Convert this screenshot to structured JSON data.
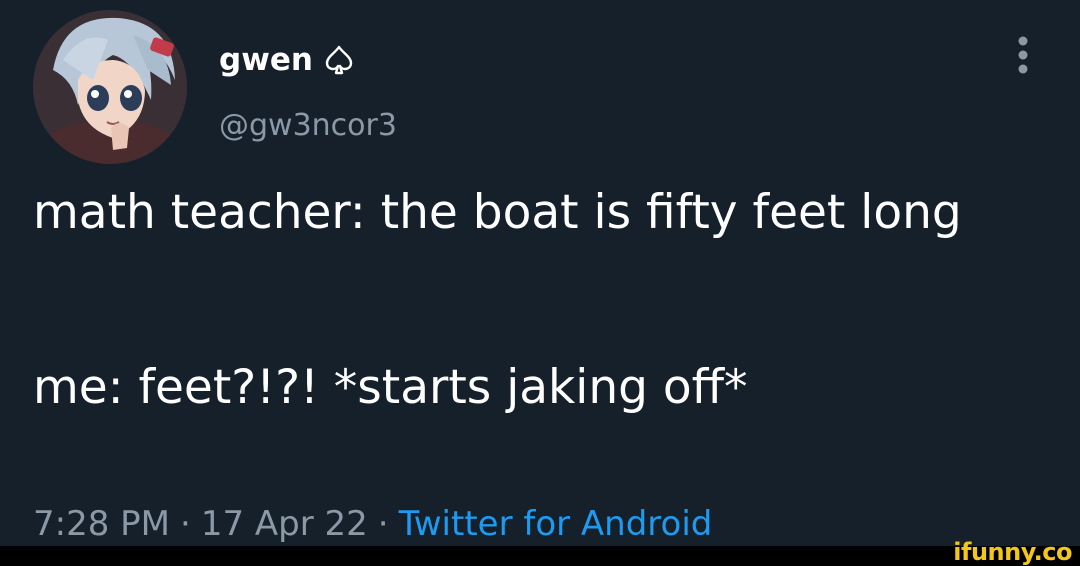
{
  "user": {
    "display_name": "gwen",
    "name_badge_icon": "spade-outline-icon",
    "handle": "@gw3ncor3",
    "avatar": "anime-character-avatar"
  },
  "menu": {
    "icon": "more-vertical-icon"
  },
  "tweet": {
    "line1": "math teacher: the boat is fifty feet long",
    "line2": "me: feet?!?! *starts jaking off*"
  },
  "meta": {
    "time": "7:28 PM",
    "separator": "·",
    "date": "17 Apr 22",
    "source": "Twitter for Android"
  },
  "watermark": {
    "text": "ifunny.co"
  },
  "colors": {
    "background": "#15202b",
    "text": "#ffffff",
    "muted": "#8b98a5",
    "link": "#1d9bf0",
    "watermark": "#f2c719"
  }
}
